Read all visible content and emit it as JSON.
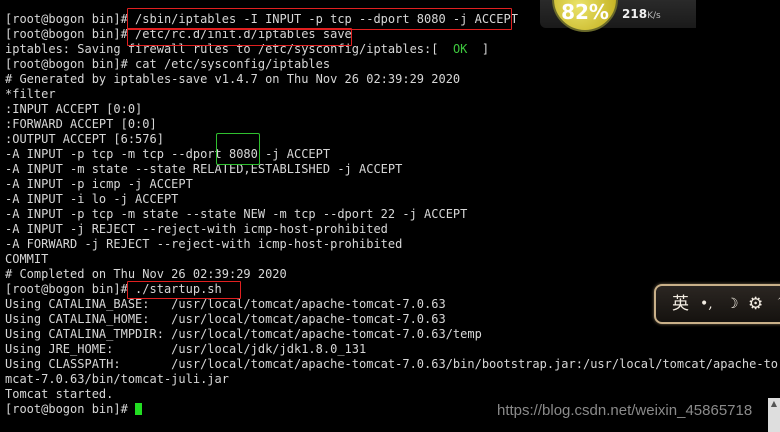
{
  "terminal": {
    "lines": [
      "[root@bogon bin]# /sbin/iptables -I INPUT -p tcp --dport 8080 -j ACCEPT",
      "[root@bogon bin]# /etc/rc.d/init.d/iptables save",
      "iptables: Saving firewall rules to /etc/sysconfig/iptables:[  ",
      "[root@bogon bin]# cat /etc/sysconfig/iptables",
      "# Generated by iptables-save v1.4.7 on Thu Nov 26 02:39:29 2020",
      "*filter",
      ":INPUT ACCEPT [0:0]",
      ":FORWARD ACCEPT [0:0]",
      ":OUTPUT ACCEPT [6:576]",
      "-A INPUT -p tcp -m tcp --dport 8080 -j ACCEPT",
      "-A INPUT -m state --state RELATED,ESTABLISHED -j ACCEPT",
      "-A INPUT -p icmp -j ACCEPT",
      "-A INPUT -i lo -j ACCEPT",
      "-A INPUT -p tcp -m state --state NEW -m tcp --dport 22 -j ACCEPT",
      "-A INPUT -j REJECT --reject-with icmp-host-prohibited",
      "-A FORWARD -j REJECT --reject-with icmp-host-prohibited",
      "COMMIT",
      "# Completed on Thu Nov 26 02:39:29 2020",
      "[root@bogon bin]# ./startup.sh",
      "Using CATALINA_BASE:   /usr/local/tomcat/apache-tomcat-7.0.63",
      "Using CATALINA_HOME:   /usr/local/tomcat/apache-tomcat-7.0.63",
      "Using CATALINA_TMPDIR: /usr/local/tomcat/apache-tomcat-7.0.63/temp",
      "Using JRE_HOME:        /usr/local/jdk/jdk1.8.0_131",
      "Using CLASSPATH:       /usr/local/tomcat/apache-tomcat-7.0.63/bin/bootstrap.jar:/usr/local/tomcat/apache-to",
      "mcat-7.0.63/bin/tomcat-juli.jar",
      "Tomcat started.",
      "[root@bogon bin]# "
    ],
    "ok_text": "OK",
    "ok_bracket_close": "  ]"
  },
  "speed_widget": {
    "percent": "82%",
    "speed_value": "218",
    "speed_unit": "K/s"
  },
  "ime_toolbar": {
    "items": [
      "英",
      "•,",
      "☽",
      "⚙",
      "↑"
    ]
  },
  "watermark": "https://blog.csdn.net/weixin_45865718",
  "colors": {
    "background": "#000000",
    "text": "#d7d7d7",
    "ok": "#3ec83e",
    "cursor": "#22dd22",
    "highlight_red": "#e02020",
    "highlight_green": "#2fbf2f"
  }
}
